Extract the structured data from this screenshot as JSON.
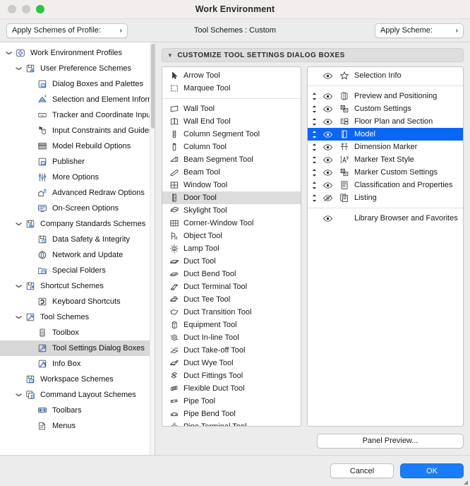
{
  "window": {
    "title": "Work Environment",
    "traffic_lights": [
      "close",
      "minimize",
      "maximize"
    ]
  },
  "toolbar": {
    "profile_button": "Apply Schemes of Profile:",
    "center_label": "Tool Schemes :  Custom",
    "scheme_button": "Apply Scheme:",
    "chevron": "›"
  },
  "sidebar": {
    "items": [
      {
        "label": "Work Environment Profiles",
        "level": 0,
        "twisty": "open",
        "icon": "work-environment-profiles-icon",
        "selected": false
      },
      {
        "label": "User Preference Schemes",
        "level": 1,
        "twisty": "open",
        "icon": "user-preference-schemes-icon",
        "selected": false
      },
      {
        "label": "Dialog Boxes and Palettes",
        "level": 2,
        "twisty": "none",
        "icon": "dialog-boxes-icon",
        "selected": false
      },
      {
        "label": "Selection and Element Information",
        "level": 2,
        "twisty": "none",
        "icon": "selection-element-info-icon",
        "selected": false
      },
      {
        "label": "Tracker and Coordinate Input",
        "level": 2,
        "twisty": "none",
        "icon": "tracker-coordinate-icon",
        "selected": false
      },
      {
        "label": "Input Constraints and Guides",
        "level": 2,
        "twisty": "none",
        "icon": "input-constraints-icon",
        "selected": false
      },
      {
        "label": "Model Rebuild Options",
        "level": 2,
        "twisty": "none",
        "icon": "model-rebuild-icon",
        "selected": false
      },
      {
        "label": "Publisher",
        "level": 2,
        "twisty": "none",
        "icon": "publisher-icon",
        "selected": false
      },
      {
        "label": "More Options",
        "level": 2,
        "twisty": "none",
        "icon": "more-options-icon",
        "selected": false
      },
      {
        "label": "Advanced Redraw Options",
        "level": 2,
        "twisty": "none",
        "icon": "advanced-redraw-icon",
        "selected": false
      },
      {
        "label": "On-Screen Options",
        "level": 2,
        "twisty": "none",
        "icon": "on-screen-options-icon",
        "selected": false
      },
      {
        "label": "Company Standards Schemes",
        "level": 1,
        "twisty": "open",
        "icon": "company-standards-icon",
        "selected": false
      },
      {
        "label": "Data Safety & Integrity",
        "level": 2,
        "twisty": "none",
        "icon": "data-safety-icon",
        "selected": false
      },
      {
        "label": "Network and Update",
        "level": 2,
        "twisty": "none",
        "icon": "network-update-icon",
        "selected": false
      },
      {
        "label": "Special Folders",
        "level": 2,
        "twisty": "none",
        "icon": "special-folders-icon",
        "selected": false
      },
      {
        "label": "Shortcut Schemes",
        "level": 1,
        "twisty": "open",
        "icon": "shortcut-schemes-icon",
        "selected": false
      },
      {
        "label": "Keyboard Shortcuts",
        "level": 2,
        "twisty": "none",
        "icon": "keyboard-shortcuts-icon",
        "selected": false
      },
      {
        "label": "Tool Schemes",
        "level": 1,
        "twisty": "open",
        "icon": "tool-schemes-icon",
        "selected": false
      },
      {
        "label": "Toolbox",
        "level": 2,
        "twisty": "none",
        "icon": "toolbox-icon",
        "selected": false
      },
      {
        "label": "Tool Settings Dialog Boxes",
        "level": 2,
        "twisty": "none",
        "icon": "tool-settings-dialog-icon",
        "selected": true
      },
      {
        "label": "Info Box",
        "level": 2,
        "twisty": "none",
        "icon": "info-box-icon",
        "selected": false
      },
      {
        "label": "Workspace Schemes",
        "level": 1,
        "twisty": "none",
        "icon": "workspace-schemes-icon",
        "selected": false
      },
      {
        "label": "Command Layout Schemes",
        "level": 1,
        "twisty": "open",
        "icon": "command-layout-icon",
        "selected": false
      },
      {
        "label": "Toolbars",
        "level": 2,
        "twisty": "none",
        "icon": "toolbars-icon",
        "selected": false
      },
      {
        "label": "Menus",
        "level": 2,
        "twisty": "none",
        "icon": "menus-icon",
        "selected": false
      }
    ]
  },
  "section": {
    "header": "CUSTOMIZE TOOL SETTINGS DIALOG BOXES",
    "triangle": "▼"
  },
  "tool_list": {
    "groups": [
      {
        "items": [
          {
            "label": "Arrow Tool",
            "icon": "arrow-tool-icon",
            "selected": false
          },
          {
            "label": "Marquee Tool",
            "icon": "marquee-tool-icon",
            "selected": false
          }
        ]
      },
      {
        "items": [
          {
            "label": "Wall Tool",
            "icon": "wall-tool-icon",
            "selected": false
          },
          {
            "label": "Wall End Tool",
            "icon": "wall-end-tool-icon",
            "selected": false
          },
          {
            "label": "Column Segment Tool",
            "icon": "column-segment-tool-icon",
            "selected": false
          },
          {
            "label": "Column Tool",
            "icon": "column-tool-icon",
            "selected": false
          },
          {
            "label": "Beam Segment Tool",
            "icon": "beam-segment-tool-icon",
            "selected": false
          },
          {
            "label": "Beam Tool",
            "icon": "beam-tool-icon",
            "selected": false
          },
          {
            "label": "Window Tool",
            "icon": "window-tool-icon",
            "selected": false
          },
          {
            "label": "Door Tool",
            "icon": "door-tool-icon",
            "selected": true
          },
          {
            "label": "Skylight Tool",
            "icon": "skylight-tool-icon",
            "selected": false
          },
          {
            "label": "Corner-Window Tool",
            "icon": "corner-window-tool-icon",
            "selected": false
          },
          {
            "label": "Object Tool",
            "icon": "object-tool-icon",
            "selected": false
          },
          {
            "label": "Lamp Tool",
            "icon": "lamp-tool-icon",
            "selected": false
          },
          {
            "label": "Duct Tool",
            "icon": "duct-tool-icon",
            "selected": false
          },
          {
            "label": "Duct Bend Tool",
            "icon": "duct-bend-tool-icon",
            "selected": false
          },
          {
            "label": "Duct Terminal Tool",
            "icon": "duct-terminal-tool-icon",
            "selected": false
          },
          {
            "label": "Duct Tee Tool",
            "icon": "duct-tee-tool-icon",
            "selected": false
          },
          {
            "label": "Duct Transition Tool",
            "icon": "duct-transition-tool-icon",
            "selected": false
          },
          {
            "label": "Equipment Tool",
            "icon": "equipment-tool-icon",
            "selected": false
          },
          {
            "label": "Duct In-line Tool",
            "icon": "duct-inline-tool-icon",
            "selected": false
          },
          {
            "label": "Duct Take-off Tool",
            "icon": "duct-takeoff-tool-icon",
            "selected": false
          },
          {
            "label": "Duct Wye Tool",
            "icon": "duct-wye-tool-icon",
            "selected": false
          },
          {
            "label": "Duct Fittings Tool",
            "icon": "duct-fittings-tool-icon",
            "selected": false
          },
          {
            "label": "Flexible Duct Tool",
            "icon": "flexible-duct-tool-icon",
            "selected": false
          },
          {
            "label": "Pipe Tool",
            "icon": "pipe-tool-icon",
            "selected": false
          },
          {
            "label": "Pipe Bend Tool",
            "icon": "pipe-bend-tool-icon",
            "selected": false
          },
          {
            "label": "Pipe Terminal Tool",
            "icon": "pipe-terminal-tool-icon",
            "selected": false
          }
        ]
      }
    ]
  },
  "panel_list": {
    "groups": [
      {
        "items": [
          {
            "label": "Selection Info",
            "icon": "selection-info-icon",
            "eye": "visible",
            "draggable": false,
            "selected": false
          }
        ]
      },
      {
        "items": [
          {
            "label": "Preview and Positioning",
            "icon": "preview-positioning-icon",
            "eye": "visible",
            "draggable": true,
            "selected": false
          },
          {
            "label": "Custom Settings",
            "icon": "custom-settings-icon",
            "eye": "visible",
            "draggable": true,
            "selected": false
          },
          {
            "label": "Floor Plan and Section",
            "icon": "floor-plan-section-icon",
            "eye": "visible",
            "draggable": true,
            "selected": false
          },
          {
            "label": "Model",
            "icon": "model-icon",
            "eye": "visible",
            "draggable": true,
            "selected": true
          },
          {
            "label": "Dimension Marker",
            "icon": "dimension-marker-icon",
            "eye": "visible",
            "draggable": true,
            "selected": false
          },
          {
            "label": "Marker Text Style",
            "icon": "marker-text-style-icon",
            "eye": "visible",
            "draggable": true,
            "selected": false
          },
          {
            "label": "Marker Custom Settings",
            "icon": "marker-custom-settings-icon",
            "eye": "visible",
            "draggable": true,
            "selected": false
          },
          {
            "label": "Classification and Properties",
            "icon": "classification-properties-icon",
            "eye": "visible",
            "draggable": true,
            "selected": false
          },
          {
            "label": "Listing",
            "icon": "listing-icon",
            "eye": "hidden",
            "draggable": true,
            "selected": false
          }
        ]
      },
      {
        "items": [
          {
            "label": "Library Browser and Favorites",
            "icon": "none",
            "eye": "visible",
            "draggable": false,
            "selected": false
          }
        ]
      }
    ]
  },
  "buttons": {
    "panel_preview": "Panel Preview...",
    "cancel": "Cancel",
    "ok": "OK"
  },
  "colors": {
    "accent_blue": "#0a66f5",
    "ok_blue": "#1a7cf7",
    "selection_gray": "#dcdcdc",
    "window_bg": "#ececec",
    "titlebar_bg": "#f2eeee",
    "maximize_green": "#29c53f"
  }
}
